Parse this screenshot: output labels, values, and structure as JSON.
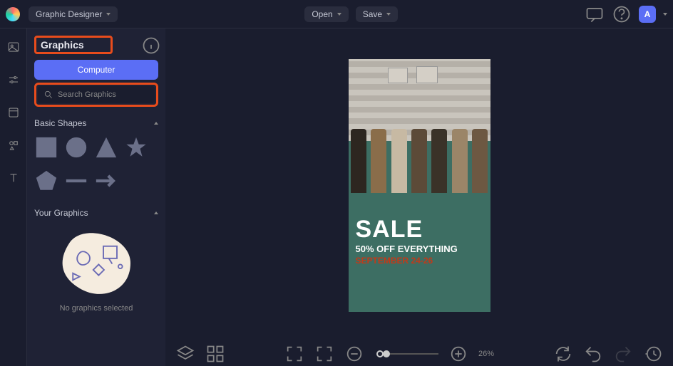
{
  "topbar": {
    "role_label": "Graphic Designer",
    "open_label": "Open",
    "save_label": "Save",
    "avatar_letter": "A"
  },
  "sidebar": {
    "title": "Graphics",
    "computer_label": "Computer",
    "search_placeholder": "Search Graphics",
    "sections": {
      "basic_shapes": {
        "label": "Basic Shapes"
      },
      "your_graphics": {
        "label": "Your Graphics",
        "empty_text": "No graphics selected"
      }
    }
  },
  "canvas": {
    "text": {
      "headline": "SALE",
      "subhead": "50% OFF EVERYTHING",
      "dates": "SEPTEMBER 24-26"
    }
  },
  "bottombar": {
    "zoom_label": "26%"
  },
  "colors": {
    "accent": "#5b6ef5",
    "highlight": "#e84c1c",
    "artboard_bg": "#3d6e63"
  }
}
